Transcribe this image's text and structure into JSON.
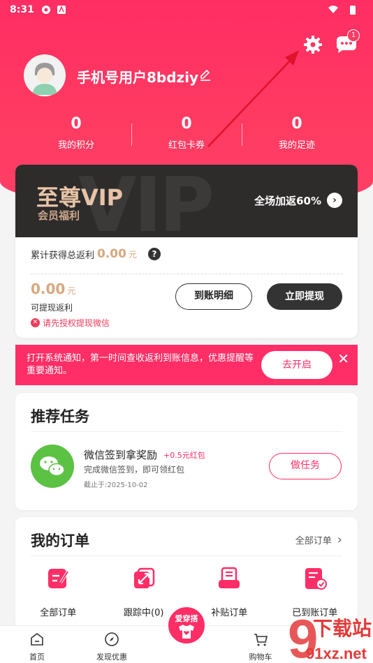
{
  "status_bar": {
    "time": "8:31"
  },
  "header": {
    "username": "手机号用户8bdziy",
    "message_badge": "1",
    "stats": [
      {
        "value": "0",
        "label": "我的积分"
      },
      {
        "value": "0",
        "label": "红包卡券"
      },
      {
        "value": "0",
        "label": "我的足迹"
      }
    ]
  },
  "vip": {
    "bg_text": "VIP",
    "title": "至尊VIP",
    "subtitle": "会员福利",
    "promo": "全场加返60%",
    "total_label": "累计获得总返利",
    "total_amount": "0.00",
    "total_unit": "元",
    "withdrawable_amount": "0.00",
    "withdrawable_unit": "元",
    "withdrawable_label": "可提现返利",
    "auth_hint": "请先授权提现微信",
    "detail_button": "到账明细",
    "withdraw_button": "立即提现"
  },
  "notice": {
    "text": "打开系统通知，第一时间查收返利到账信息，优惠提醒等重要通知。",
    "button": "去开启"
  },
  "tasks": {
    "title": "推荐任务",
    "items": [
      {
        "name": "微信签到拿奖励",
        "reward": "+0.5元红包",
        "desc": "完成微信签到，即可领红包",
        "deadline": "截止于:2025-10-02",
        "button": "做任务"
      }
    ]
  },
  "orders": {
    "title": "我的订单",
    "all_link": "全部订单",
    "items": [
      {
        "label": "全部订单",
        "icon": "order-list-icon"
      },
      {
        "label": "跟踪中(0)",
        "icon": "tracking-icon"
      },
      {
        "label": "补贴订单",
        "icon": "subsidy-icon"
      },
      {
        "label": "已到账订单",
        "icon": "received-icon"
      }
    ]
  },
  "bottom_nav": {
    "items": [
      {
        "label": "首页"
      },
      {
        "label": "发现优惠"
      },
      {
        "label": "爱穿搭"
      },
      {
        "label": "购物车"
      }
    ]
  },
  "watermark": {
    "text1": "下载站",
    "text2": "91xz.net"
  },
  "colors": {
    "brand": "#ff2e66",
    "vip_gold": "#d7a77e",
    "vip_dark": "#2e2b2b"
  }
}
